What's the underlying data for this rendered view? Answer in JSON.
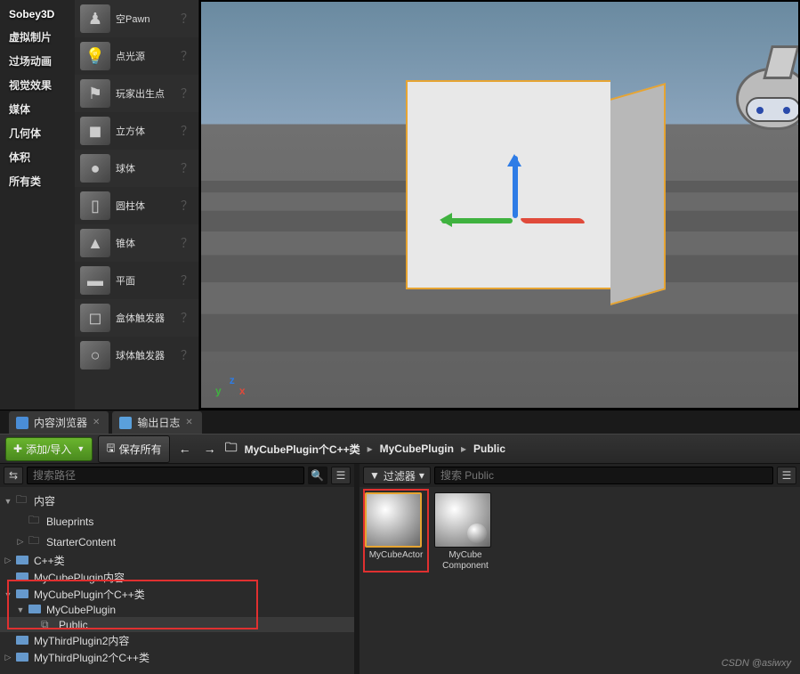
{
  "sidebar_categories": [
    "Sobey3D",
    "虚拟制片",
    "过场动画",
    "视觉效果",
    "媒体",
    "几何体",
    "体积",
    "所有类"
  ],
  "place_items": [
    {
      "label": "空Pawn",
      "icon": "♟"
    },
    {
      "label": "点光源",
      "icon": "💡"
    },
    {
      "label": "玩家出生点",
      "icon": "⚑"
    },
    {
      "label": "立方体",
      "icon": "◼"
    },
    {
      "label": "球体",
      "icon": "●"
    },
    {
      "label": "圆柱体",
      "icon": "▯"
    },
    {
      "label": "锥体",
      "icon": "▲"
    },
    {
      "label": "平面",
      "icon": "▬"
    },
    {
      "label": "盒体触发器",
      "icon": "◻"
    },
    {
      "label": "球体触发器",
      "icon": "○"
    }
  ],
  "coord_axes": {
    "x": "x",
    "y": "y",
    "z": "z"
  },
  "tabs": [
    {
      "label": "内容浏览器",
      "active": true
    },
    {
      "label": "输出日志",
      "active": false
    }
  ],
  "toolbar": {
    "add_import": "添加/导入",
    "save_all": "保存所有"
  },
  "breadcrumb": [
    "MyCubePlugin个C++类",
    "MyCubePlugin",
    "Public"
  ],
  "search": {
    "placeholder_left": "搜索路径",
    "filter_label": "过滤器",
    "placeholder_right": "搜索 Public"
  },
  "tree": [
    {
      "label": "内容",
      "indent": 0,
      "exp": "▼",
      "folder": "dark"
    },
    {
      "label": "Blueprints",
      "indent": 1,
      "exp": "",
      "folder": "dark"
    },
    {
      "label": "StarterContent",
      "indent": 1,
      "exp": "▷",
      "folder": "dark"
    },
    {
      "label": "C++类",
      "indent": 0,
      "exp": "▷",
      "folder": "blue"
    },
    {
      "label": "MyCubePlugin内容",
      "indent": 0,
      "exp": "",
      "folder": "blue"
    },
    {
      "label": "MyCubePlugin个C++类",
      "indent": 0,
      "exp": "▼",
      "folder": "blue",
      "hl": true
    },
    {
      "label": "MyCubePlugin",
      "indent": 1,
      "exp": "▼",
      "folder": "blue",
      "hl": true
    },
    {
      "label": "Public",
      "indent": 2,
      "exp": "",
      "folder": "code",
      "hl": true,
      "selected": true
    },
    {
      "label": "MyThirdPlugin2内容",
      "indent": 0,
      "exp": "",
      "folder": "blue"
    },
    {
      "label": "MyThirdPlugin2个C++类",
      "indent": 0,
      "exp": "▷",
      "folder": "blue"
    }
  ],
  "assets": [
    {
      "label": "MyCubeActor",
      "selected": true,
      "double": false
    },
    {
      "label": "MyCube Component",
      "selected": false,
      "double": true
    }
  ],
  "watermark": "CSDN @asiwxy"
}
